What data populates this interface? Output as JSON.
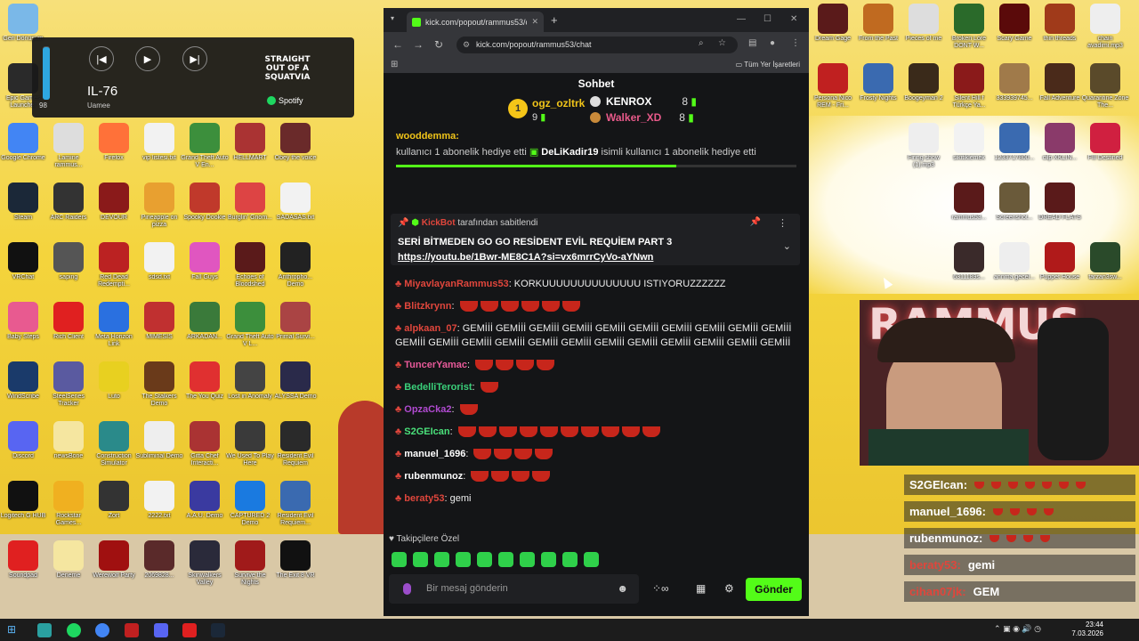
{
  "desktop": {
    "icons_left": [
      {
        "label": "Geri Dönüşüm",
        "color": "#7ab8e8",
        "col": 0,
        "row": 0
      },
      {
        "label": "Epic Games Launcher",
        "color": "#2a2a2a",
        "col": 0,
        "row": 1
      },
      {
        "label": "Google Chrome",
        "color": "#4285f4",
        "col": 0,
        "row": 2
      },
      {
        "label": "Lamine rammus...",
        "color": "#dddddd",
        "col": 1,
        "row": 2
      },
      {
        "label": "Firefox",
        "color": "#ff7139",
        "col": 2,
        "row": 2
      },
      {
        "label": "vip listesi.txt",
        "color": "#f2f2f2",
        "col": 3,
        "row": 2
      },
      {
        "label": "Grand Theft Auto V En...",
        "color": "#3c8f3c",
        "col": 4,
        "row": 2
      },
      {
        "label": "HELLMART",
        "color": "#a33",
        "col": 5,
        "row": 2
      },
      {
        "label": "Obey the voice",
        "color": "#6a2a2a",
        "col": 6,
        "row": 2
      },
      {
        "label": "Steam",
        "color": "#1b2838",
        "col": 0,
        "row": 3
      },
      {
        "label": "ARC Raiders",
        "color": "#333",
        "col": 1,
        "row": 3
      },
      {
        "label": "DEVOUR",
        "color": "#8a1a1a",
        "col": 2,
        "row": 3
      },
      {
        "label": "Pineapple on pizza",
        "color": "#e8a030",
        "col": 3,
        "row": 3
      },
      {
        "label": "Spooky Dookie",
        "color": "#c0392b",
        "col": 4,
        "row": 3
      },
      {
        "label": "Burglin' Gnom...",
        "color": "#d44",
        "col": 5,
        "row": 3
      },
      {
        "label": "SADASAS.txt",
        "color": "#f2f2f2",
        "col": 6,
        "row": 3
      },
      {
        "label": "VRChat",
        "color": "#111",
        "col": 0,
        "row": 4
      },
      {
        "label": "saping",
        "color": "#555",
        "col": 1,
        "row": 4
      },
      {
        "label": "Red Dead Redempti...",
        "color": "#b22",
        "col": 2,
        "row": 4
      },
      {
        "label": "sdsd.txt",
        "color": "#f2f2f2",
        "col": 3,
        "row": 4
      },
      {
        "label": "Fall Guys",
        "color": "#e056c0",
        "col": 4,
        "row": 4
      },
      {
        "label": "Echoes of Bloodshed",
        "color": "#5a1a1a",
        "col": 5,
        "row": 4
      },
      {
        "label": "Anthropho... Demo",
        "color": "#222",
        "col": 6,
        "row": 4
      },
      {
        "label": "Baby Steps",
        "color": "#e85a90",
        "col": 0,
        "row": 5
      },
      {
        "label": "Rich Client",
        "color": "#e02020",
        "col": 1,
        "row": 5
      },
      {
        "label": "Meta Horizon Link",
        "color": "#2a70e0",
        "col": 2,
        "row": 5
      },
      {
        "label": "MIMESIS",
        "color": "#c03030",
        "col": 3,
        "row": 5
      },
      {
        "label": "ARKADAN...",
        "color": "#3a7a3a",
        "col": 4,
        "row": 5
      },
      {
        "label": "Grand Theft Auto V L...",
        "color": "#3c8f3c",
        "col": 5,
        "row": 5
      },
      {
        "label": "Primal Survi...",
        "color": "#a44",
        "col": 6,
        "row": 5
      },
      {
        "label": "WindScribe",
        "color": "#1a3a6a",
        "col": 0,
        "row": 6
      },
      {
        "label": "SteelSeries Tracker",
        "color": "#5a5aa0",
        "col": 1,
        "row": 6
      },
      {
        "label": "Luto",
        "color": "#e8d020",
        "col": 2,
        "row": 6
      },
      {
        "label": "The Stalkers Demo",
        "color": "#6a3a1a",
        "col": 3,
        "row": 6
      },
      {
        "label": "The You Quiz",
        "color": "#e03030",
        "col": 4,
        "row": 6
      },
      {
        "label": "Lost in Anomaly",
        "color": "#444",
        "col": 5,
        "row": 6
      },
      {
        "label": "ALYSSA Demo",
        "color": "#2a2a4a",
        "col": 6,
        "row": 6
      },
      {
        "label": "Discord",
        "color": "#5865f2",
        "col": 0,
        "row": 7
      },
      {
        "label": "newsBone",
        "color": "#f5e6a0",
        "col": 1,
        "row": 7
      },
      {
        "label": "Construction Simulator",
        "color": "#2a8a8a",
        "col": 2,
        "row": 7
      },
      {
        "label": "Subliminal Demo",
        "color": "#eee",
        "col": 3,
        "row": 7
      },
      {
        "label": "Gitta Chef Interacti...",
        "color": "#a33",
        "col": 4,
        "row": 7
      },
      {
        "label": "We Used To Play Here",
        "color": "#3a3a3a",
        "col": 5,
        "row": 7
      },
      {
        "label": "Resident Evil Requiem",
        "color": "#2a2a2a",
        "col": 6,
        "row": 7
      },
      {
        "label": "Logitech G HUB",
        "color": "#111",
        "col": 0,
        "row": 8
      },
      {
        "label": "Rockstar Games...",
        "color": "#f0b020",
        "col": 1,
        "row": 8
      },
      {
        "label": "Zort",
        "color": "#333",
        "col": 2,
        "row": 8
      },
      {
        "label": "2222.txt",
        "color": "#f2f2f2",
        "col": 3,
        "row": 8
      },
      {
        "label": "A.A.U. Demo",
        "color": "#3a3aa0",
        "col": 4,
        "row": 8
      },
      {
        "label": "CAPTURED 2 Demo",
        "color": "#1a7ae0",
        "col": 5,
        "row": 8
      },
      {
        "label": "Resident Evil Requiem...",
        "color": "#3a6ab0",
        "col": 6,
        "row": 8
      },
      {
        "label": "Soundpad",
        "color": "#e02020",
        "col": 0,
        "row": 9
      },
      {
        "label": "Deneme",
        "color": "#f5e6a0",
        "col": 1,
        "row": 9
      },
      {
        "label": "Werewolf Party",
        "color": "#a01010",
        "col": 2,
        "row": 9
      },
      {
        "label": "2069828...",
        "color": "#5a2a2a",
        "col": 3,
        "row": 9
      },
      {
        "label": "Skinwalkers Valley",
        "color": "#2a2a3a",
        "col": 4,
        "row": 9
      },
      {
        "label": "Survive the Nights",
        "color": "#a01a1a",
        "col": 5,
        "row": 9
      },
      {
        "label": "The Exit 8 VR",
        "color": "#111",
        "col": 6,
        "row": 9
      }
    ],
    "icons_right": [
      {
        "label": "Dream Gage",
        "color": "#5a1a1a",
        "col": 0,
        "row": 0
      },
      {
        "label": "From the Past",
        "color": "#c06a20",
        "col": 1,
        "row": 0
      },
      {
        "label": "Pieces of me",
        "color": "#ddd",
        "col": 2,
        "row": 0
      },
      {
        "label": "Broken Lore DONT W...",
        "color": "#2a6a2a",
        "col": 3,
        "row": 0
      },
      {
        "label": "Scary Game",
        "color": "#5a0a0a",
        "col": 4,
        "row": 0
      },
      {
        "label": "thin threads",
        "color": "#a03a1a",
        "col": 5,
        "row": 0
      },
      {
        "label": "chain avadimi.mp3",
        "color": "#eee",
        "col": 6,
        "row": 0
      },
      {
        "label": "Persona Nico REM - Fri...",
        "color": "#c02020",
        "col": 0,
        "row": 1
      },
      {
        "label": "Frosty Nights",
        "color": "#3a6ab0",
        "col": 1,
        "row": 1
      },
      {
        "label": "Boogeyman 2",
        "color": "#3a2a1a",
        "col": 2,
        "row": 1
      },
      {
        "label": "Silent Hill f Türkçe Ya...",
        "color": "#8a1a1a",
        "col": 3,
        "row": 1
      },
      {
        "label": "333939745...",
        "color": "#a07a4a",
        "col": 4,
        "row": 1
      },
      {
        "label": "Fall Adventure",
        "color": "#4a2a1a",
        "col": 5,
        "row": 1
      },
      {
        "label": "Quarantine Zone The...",
        "color": "#5a4a2a",
        "col": 6,
        "row": 1
      },
      {
        "label": "Firing show (1).mp3",
        "color": "#eee",
        "col": 2,
        "row": 2
      },
      {
        "label": "sikitiklemek",
        "color": "#f2f2f2",
        "col": 3,
        "row": 2
      },
      {
        "label": "1233717800...",
        "color": "#3a6ab0",
        "col": 4,
        "row": 2
      },
      {
        "label": "cilp XKLIN...",
        "color": "#8a3a6a",
        "col": 5,
        "row": 2
      },
      {
        "label": "FIll Destined",
        "color": "#d02040",
        "col": 6,
        "row": 2
      },
      {
        "label": "rammus53...",
        "color": "#5a1a1a",
        "col": 3,
        "row": 3
      },
      {
        "label": "Screenshot...",
        "color": "#6a5a3a",
        "col": 4,
        "row": 3
      },
      {
        "label": "DREAD FLATS",
        "color": "#5a1a1a",
        "col": 5,
        "row": 3
      },
      {
        "label": "6311189s...",
        "color": "#3a2a2a",
        "col": 3,
        "row": 4
      },
      {
        "label": "annma gecel...",
        "color": "#eee",
        "col": 4,
        "row": 4
      },
      {
        "label": "Puppet House",
        "color": "#b01a1a",
        "col": 5,
        "row": 4
      },
      {
        "label": "tarzan3sw...",
        "color": "#2a4a2a",
        "col": 6,
        "row": 4
      }
    ]
  },
  "spotify": {
    "volume_value": "98",
    "volume_fraction": 0.98,
    "track_title": "IL-76",
    "artist": "Uamee",
    "cover_text": "STRAIGHT OUT OF A SQUATVIA",
    "brand": "Spotify",
    "prev_icon": "previous-icon",
    "play_icon": "play-icon",
    "next_icon": "next-icon"
  },
  "browser": {
    "tab_title": "kick.com/popout/rammus53/ch",
    "url": "kick.com/popout/rammus53/chat",
    "bookmarks_all": "Tüm Yer İşaretleri",
    "accent": "#53fc18"
  },
  "chat": {
    "header": "Sohbet",
    "leaderboard": [
      {
        "rank": "1",
        "name": "ogz_ozltrk",
        "count": "9",
        "color": "#f0c419"
      },
      {
        "rank": "2",
        "name": "KENROX",
        "count": "8",
        "color": "#ffffff"
      },
      {
        "rank": "3",
        "name": "Walker_XD",
        "count": "8",
        "color": "#e85a8a"
      }
    ],
    "gift_user": "wooddemma:",
    "gift_text_prefix": "kullanıcı 1 abonelik hediye etti",
    "gift_user2": "DeLiKadir19",
    "gift_text_suffix": "isimli kullanıcı 1 abonelik hediye etti",
    "gift_progress": 0.7,
    "pinned": {
      "by_user": "KickBot",
      "by_text": "tarafından sabitlendi",
      "title": "SERİ BİTMEDEN GO GO RESİDENT EVİL REQUİEM PART 3",
      "link": "https://youtu.be/1Bwr-ME8C1A?si=vx6mrrCyVo-aYNwn"
    },
    "messages": [
      {
        "user": "MiyavlayanRammus53",
        "color": "#e0463c",
        "text": ": KORKUUUUUUUUUUUUUU ISTIYORUZZZZZZ",
        "cups": 0
      },
      {
        "user": "Blitzkrynn",
        "color": "#e0463c",
        "text": ":",
        "cups": 6
      },
      {
        "user": "alpkaan_07",
        "color": "#e0463c",
        "text": ": GEMİİİ GEMİİİ GEMİİİ GEMİİİ GEMİİİ GEMİİİ GEMİİİ GEMİİİ GEMİİİ GEMİİİ GEMİİİ GEMİİİ GEMİİİ GEMİİİ GEMİİİ GEMİİİ GEMİİİ GEMİİİ GEMİİİ GEMİİİ GEMİİİ GEMİİİ",
        "cups": 0
      },
      {
        "user": "TuncerYamac",
        "color": "#e85a9a",
        "text": ":",
        "cups": 4
      },
      {
        "user": "BedelliTerorist",
        "color": "#3ad07a",
        "text": ":",
        "cups": 1
      },
      {
        "user": "OpzaCka2",
        "color": "#b04ad0",
        "text": ":",
        "cups": 1
      },
      {
        "user": "S2GEIcan",
        "color": "#4ae07a",
        "text": ":",
        "cups": 10
      },
      {
        "user": "manuel_1696",
        "color": "#ffffff",
        "text": ":",
        "cups": 4
      },
      {
        "user": "rubenmunoz",
        "color": "#ffffff",
        "text": ":",
        "cups": 4
      },
      {
        "user": "beraty53",
        "color": "#e0463c",
        "text": ": gemi",
        "cups": 0
      }
    ],
    "followers_only": "Takipçilere Özel",
    "input_placeholder": "Bir mesaj gönderin",
    "send_label": "Gönder"
  },
  "overlay": {
    "webcam_sign": "RAMMUS",
    "messages": [
      {
        "user": "S2GEIcan:",
        "text": "",
        "cups": 7,
        "color": "#ffffff"
      },
      {
        "user": "manuel_1696:",
        "text": "",
        "cups": 4,
        "color": "#ffffff"
      },
      {
        "user": "rubenmunoz:",
        "text": "",
        "cups": 4,
        "color": "#ffffff"
      },
      {
        "user": "beraty53:",
        "text": "gemi",
        "cups": 0,
        "color": "#e0463c"
      },
      {
        "user": "cihan07jk:",
        "text": "GEM",
        "cups": 0,
        "color": "#e0463c"
      }
    ]
  },
  "taskbar": {
    "time": "23:44",
    "date": "7.03.2026"
  }
}
